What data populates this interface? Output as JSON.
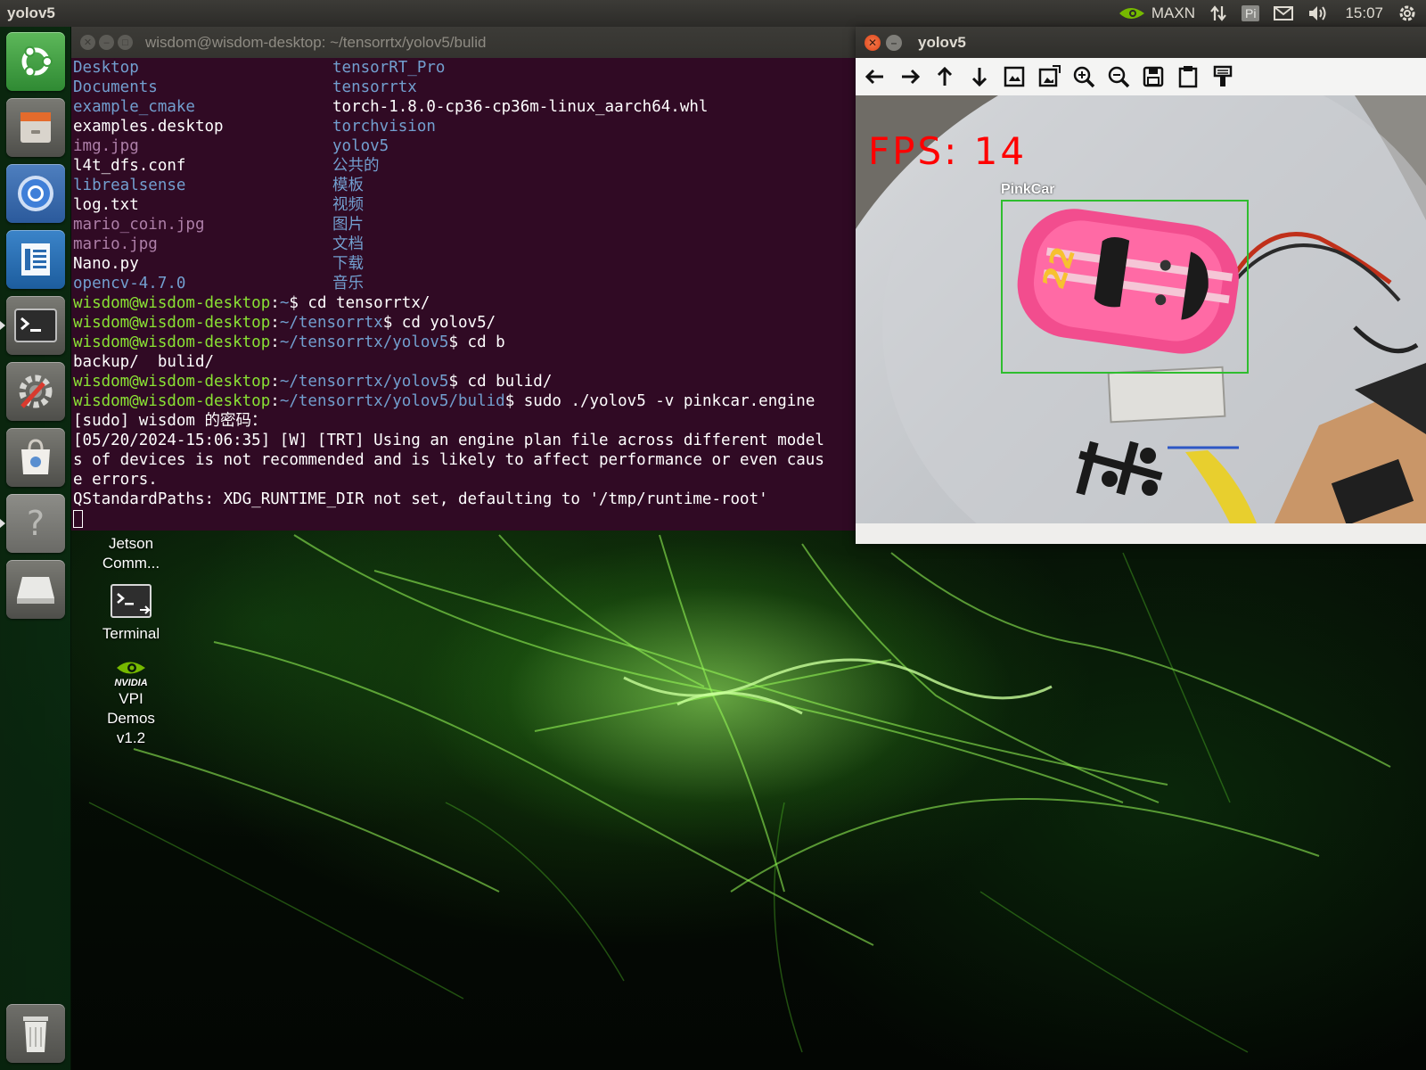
{
  "top_panel": {
    "app_name": "yolov5",
    "power_mode": "MAXN",
    "pi_badge": "Pi",
    "clock": "15:07"
  },
  "launcher": {
    "items": [
      {
        "name": "ubuntu-dash-icon"
      },
      {
        "name": "files-icon"
      },
      {
        "name": "chromium-icon"
      },
      {
        "name": "libreoffice-writer-icon"
      },
      {
        "name": "terminal-icon"
      },
      {
        "name": "system-settings-icon"
      },
      {
        "name": "software-center-icon"
      },
      {
        "name": "help-icon"
      },
      {
        "name": "drive-icon"
      },
      {
        "name": "trash-icon"
      }
    ]
  },
  "terminal": {
    "title": "wisdom@wisdom-desktop: ~/tensorrtx/yolov5/bulid",
    "listing": [
      {
        "left": "Desktop",
        "left_type": "dir",
        "right": "tensorRT_Pro",
        "right_type": "dir"
      },
      {
        "left": "Documents",
        "left_type": "dir",
        "right": "tensorrtx",
        "right_type": "dir"
      },
      {
        "left": "example_cmake",
        "left_type": "dir",
        "right": "torch-1.8.0-cp36-cp36m-linux_aarch64.whl",
        "right_type": "file"
      },
      {
        "left": "examples.desktop",
        "left_type": "file",
        "right": "torchvision",
        "right_type": "dir"
      },
      {
        "left": "img.jpg",
        "left_type": "img",
        "right": "yolov5",
        "right_type": "dir"
      },
      {
        "left": "l4t_dfs.conf",
        "left_type": "file",
        "right": "公共的",
        "right_type": "dir"
      },
      {
        "left": "librealsense",
        "left_type": "dir",
        "right": "模板",
        "right_type": "dir"
      },
      {
        "left": "log.txt",
        "left_type": "file",
        "right": "视频",
        "right_type": "dir"
      },
      {
        "left": "mario_coin.jpg",
        "left_type": "img",
        "right": "图片",
        "right_type": "dir"
      },
      {
        "left": "mario.jpg",
        "left_type": "img",
        "right": "文档",
        "right_type": "dir"
      },
      {
        "left": "Nano.py",
        "left_type": "file",
        "right": "下载",
        "right_type": "dir"
      },
      {
        "left": "opencv-4.7.0",
        "left_type": "dir",
        "right": "音乐",
        "right_type": "dir"
      }
    ],
    "prompt_user": "wisdom@wisdom-desktop",
    "commands": [
      {
        "path": "~",
        "cmd": "$ cd tensorrtx/"
      },
      {
        "path": "~/tensorrtx",
        "cmd": "$ cd yolov5/"
      },
      {
        "path": "~/tensorrtx/yolov5",
        "cmd": "$ cd b"
      }
    ],
    "completion": "backup/  bulid/",
    "commands2": [
      {
        "path": "~/tensorrtx/yolov5",
        "cmd": "$ cd bulid/"
      },
      {
        "path": "~/tensorrtx/yolov5/bulid",
        "cmd": "$ sudo ./yolov5 -v pinkcar.engine"
      }
    ],
    "output": [
      "[sudo] wisdom 的密码：",
      "[05/20/2024-15:06:35] [W] [TRT] Using an engine plan file across different model",
      "s of devices is not recommended and is likely to affect performance or even caus",
      "e errors.",
      "QStandardPaths: XDG_RUNTIME_DIR not set, defaulting to '/tmp/runtime-root'"
    ]
  },
  "desktop_icons": {
    "jetson": {
      "lines": [
        "Jetson",
        "Comm..."
      ]
    },
    "terminal": {
      "label": "Terminal"
    },
    "vpi": {
      "brand": "NVIDIA",
      "lines": [
        "VPI",
        "Demos",
        "v1.2"
      ]
    }
  },
  "yolo_window": {
    "title": "yolov5",
    "toolbar": [
      {
        "name": "pan-left-icon"
      },
      {
        "name": "pan-right-icon"
      },
      {
        "name": "pan-up-icon"
      },
      {
        "name": "pan-down-icon"
      },
      {
        "name": "zoom-fit-icon"
      },
      {
        "name": "zoom-original-icon"
      },
      {
        "name": "zoom-in-icon"
      },
      {
        "name": "zoom-out-icon"
      },
      {
        "name": "save-image-icon"
      },
      {
        "name": "copy-clipboard-icon"
      },
      {
        "name": "properties-icon"
      }
    ],
    "fps_text": "FPS: 14",
    "detection": {
      "label": "PinkCar",
      "box_color": "#2fbd2f"
    }
  },
  "colors": {
    "terminal_bg": "#300a24",
    "prompt_green": "#8ae234",
    "dir_blue": "#729fcf",
    "img_magenta": "#ad7fa8",
    "fps_red": "#ff0000"
  }
}
